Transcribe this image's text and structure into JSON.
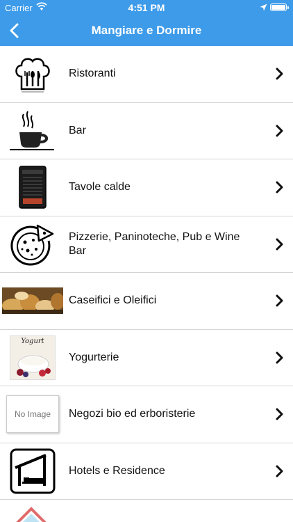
{
  "status_bar": {
    "carrier": "Carrier",
    "time": "4:51 PM",
    "wifi_icon": "wifi-icon",
    "location_icon": "location-arrow-icon",
    "battery_level": 1.0
  },
  "nav": {
    "title": "Mangiare e Dormire",
    "back_icon": "chevron-left-icon"
  },
  "colors": {
    "header_bg": "#3d9be9",
    "header_text": "#ffffff",
    "separator": "#d4d4d4"
  },
  "items": [
    {
      "label": "Ristoranti",
      "icon": "chef-hat-icon"
    },
    {
      "label": "Bar",
      "icon": "coffee-cup-icon"
    },
    {
      "label": "Tavole calde",
      "icon": "menu-board-icon"
    },
    {
      "label": "Pizzerie, Paninoteche, Pub e Wine Bar",
      "icon": "pizza-icon"
    },
    {
      "label": "Caseifici e Oleifici",
      "icon": "cheese-bread-photo"
    },
    {
      "label": "Yogurterie",
      "icon": "yogurt-photo",
      "image_text": "Yogurt"
    },
    {
      "label": "Negozi bio ed erboristerie",
      "icon": "no-image-placeholder",
      "image_text": "No Image"
    },
    {
      "label": "Hotels e Residence",
      "icon": "bed-house-icon"
    }
  ],
  "partial_item": {
    "icon": "house-roof-icon"
  }
}
